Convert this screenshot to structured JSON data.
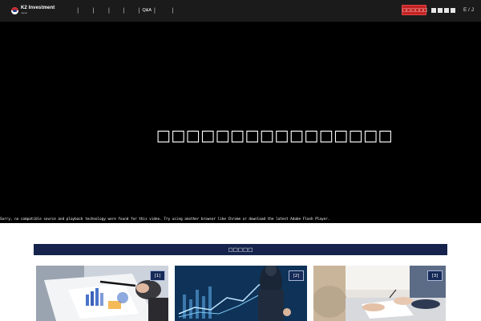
{
  "header": {
    "logo": {
      "brand": "K2 Investment",
      "tagline": "Japan"
    },
    "nav_items": [
      "",
      "",
      "",
      "",
      "Q&A",
      "",
      ""
    ],
    "contact_label": "□□□□□□",
    "util_icons": [
      "square-icon",
      "square-icon",
      "square-icon",
      "square-icon"
    ],
    "language": "E / J"
  },
  "hero": {
    "title": "□□□□□□□□□□□□□□□□",
    "video_error": "Sorry, no compatible source and playback technology were found for this video. Try using another browser like Chrome or download the latest Adobe Flash Player."
  },
  "section": {
    "title": "□□□□□",
    "cards": [
      {
        "badge": "[1]",
        "image": "analysis-documents-image"
      },
      {
        "badge": "[2]",
        "image": "financial-chart-image"
      },
      {
        "badge": "[3]",
        "image": "business-meeting-image"
      }
    ]
  },
  "colors": {
    "header_bg": "#1b1b1b",
    "accent_red": "#c32121",
    "navy": "#15234d",
    "hero_bg": "#000000"
  }
}
